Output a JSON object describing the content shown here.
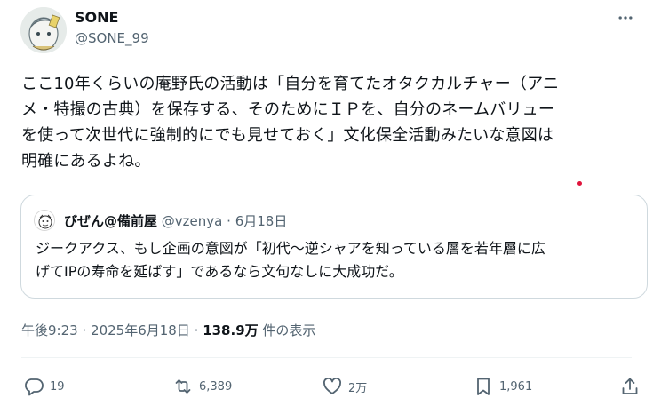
{
  "author": {
    "display_name": "SONE",
    "handle": "@SONE_99"
  },
  "tweet": {
    "lines": [
      "ここ10年くらいの庵野氏の活動は「自分を育てたオタクカルチャー（アニ",
      "メ・特撮の古典）を保存する、そのためにＩＰを、自分のネームバリュー",
      "を使って次世代に強制的にでも見せておく」文化保全活動みたいな意図は",
      "明確にあるよね。"
    ]
  },
  "quote": {
    "name": "びぜん@備前屋",
    "handle": "@vzenya",
    "separator": "·",
    "date": "6月18日",
    "lines": [
      "ジークアクス、もし企画の意図が「初代～逆シャアを知っている層を若年層に広",
      "げてIPの寿命を延ばす」であるなら文句なしに大成功だ。"
    ]
  },
  "meta": {
    "time": "午後9:23",
    "separator": "·",
    "date": "2025年6月18日",
    "views_count": "138.9万",
    "views_label": "件の表示"
  },
  "actions": {
    "reply_count": "19",
    "repost_count": "6,389",
    "like_count": "2万",
    "bookmark_count": "1,961"
  },
  "icons": {
    "more": "more-icon",
    "reply": "reply-icon",
    "repost": "repost-icon",
    "like": "heart-icon",
    "bookmark": "bookmark-icon",
    "share": "share-icon"
  },
  "colors": {
    "text": "#0f1419",
    "secondary": "#536471",
    "border": "#cfd9de",
    "dot": "#e0143c"
  }
}
